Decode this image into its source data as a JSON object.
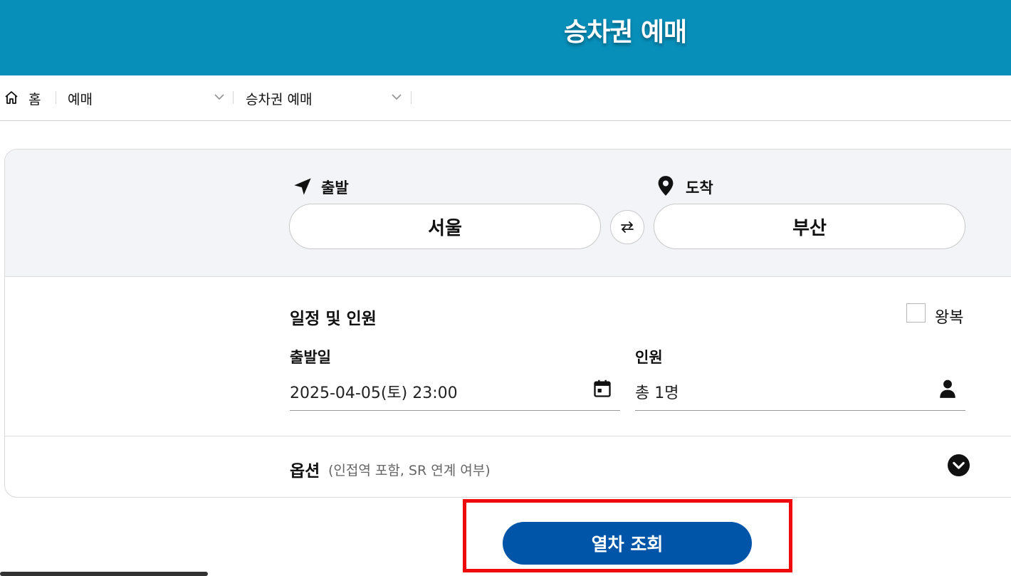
{
  "header": {
    "title": "승차권 예매"
  },
  "breadcrumb": {
    "home_label": "홈",
    "items": [
      {
        "label": "예매"
      },
      {
        "label": "승차권 예매"
      }
    ]
  },
  "route": {
    "departure_label": "출발",
    "arrival_label": "도착",
    "departure_value": "서울",
    "arrival_value": "부산"
  },
  "schedule": {
    "title": "일정 및 인원",
    "roundtrip_label": "왕복",
    "roundtrip_checked": false,
    "date_label": "출발일",
    "date_value": "2025-04-05(토) 23:00",
    "people_label": "인원",
    "people_value": "총 1명"
  },
  "options": {
    "title": "옵션",
    "description": "(인접역 포함, SR 연계 여부)"
  },
  "search_button": {
    "label": "열차 조회"
  },
  "colors": {
    "header_bg": "#078fba",
    "primary_button": "#0055a8",
    "highlight": "#ee0a0a",
    "panel_top_bg": "#f3f4f7"
  }
}
